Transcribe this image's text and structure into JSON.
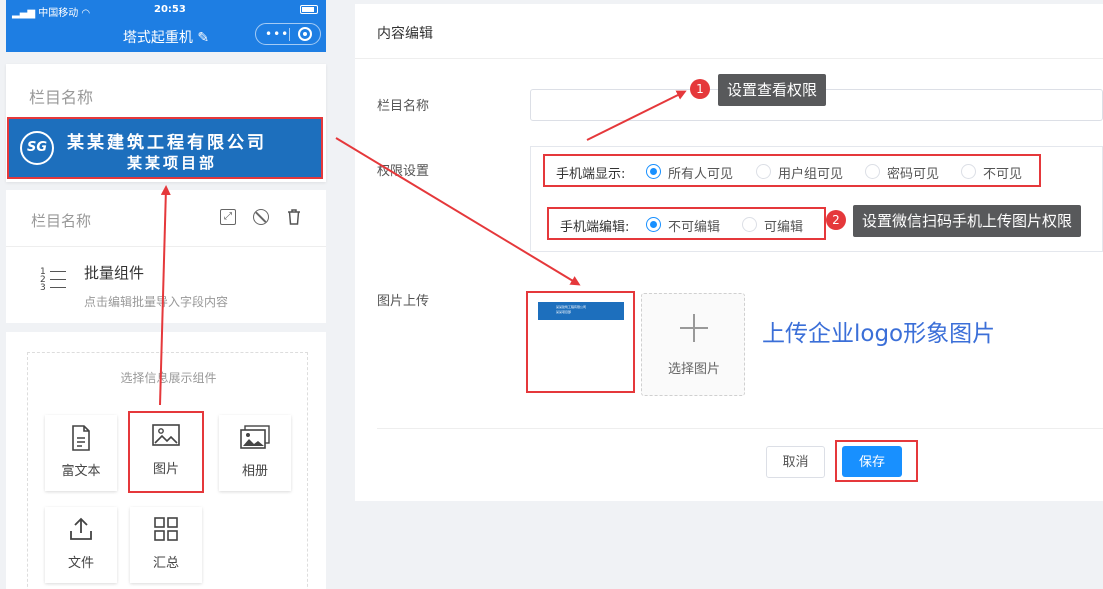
{
  "status_bar": {
    "carrier": "中国移动",
    "time": "20:53"
  },
  "mini_nav": {
    "title": "塔式起重机",
    "edit_glyph": "✎",
    "menu_glyph": "•••"
  },
  "preview": {
    "column_placeholder": "栏目名称",
    "banner": {
      "logo_text": "SG",
      "company": "某某建筑工程有限公司",
      "project": "某某项目部"
    },
    "column_placeholder_2": "栏目名称",
    "batch": {
      "title": "批量组件",
      "desc": "点击编辑批量导入字段内容",
      "num_icon": [
        "1",
        "2",
        "3"
      ]
    }
  },
  "chooser": {
    "title": "选择信息展示组件",
    "items": [
      {
        "label": "富文本",
        "icon": "document-icon"
      },
      {
        "label": "图片",
        "icon": "image-icon"
      },
      {
        "label": "相册",
        "icon": "album-icon"
      },
      {
        "label": "文件",
        "icon": "upload-icon"
      },
      {
        "label": "汇总",
        "icon": "grid-icon"
      }
    ]
  },
  "editor": {
    "title": "内容编辑",
    "column_name_label": "栏目名称",
    "column_name_value": "",
    "permission_label": "权限设置",
    "mobile_display": {
      "label": "手机端显示:",
      "options": [
        "所有人可见",
        "用户组可见",
        "密码可见",
        "不可见"
      ],
      "selected": "所有人可见"
    },
    "mobile_edit": {
      "label": "手机端编辑:",
      "options": [
        "不可编辑",
        "可编辑"
      ],
      "selected": "不可编辑"
    },
    "upload_label": "图片上传",
    "uploader_label": "选择图片",
    "upload_hint": "上传企业logo形象图片",
    "cancel_label": "取消",
    "save_label": "保存"
  },
  "annotations": {
    "tip1": {
      "num": "1",
      "text": "设置查看权限"
    },
    "tip2": {
      "num": "2",
      "text": "设置微信扫码手机上传图片权限"
    }
  },
  "colors": {
    "accent": "#1890ff",
    "nav": "#1e7ee3",
    "highlight": "#e5383b",
    "banner": "#1d6fbd"
  }
}
